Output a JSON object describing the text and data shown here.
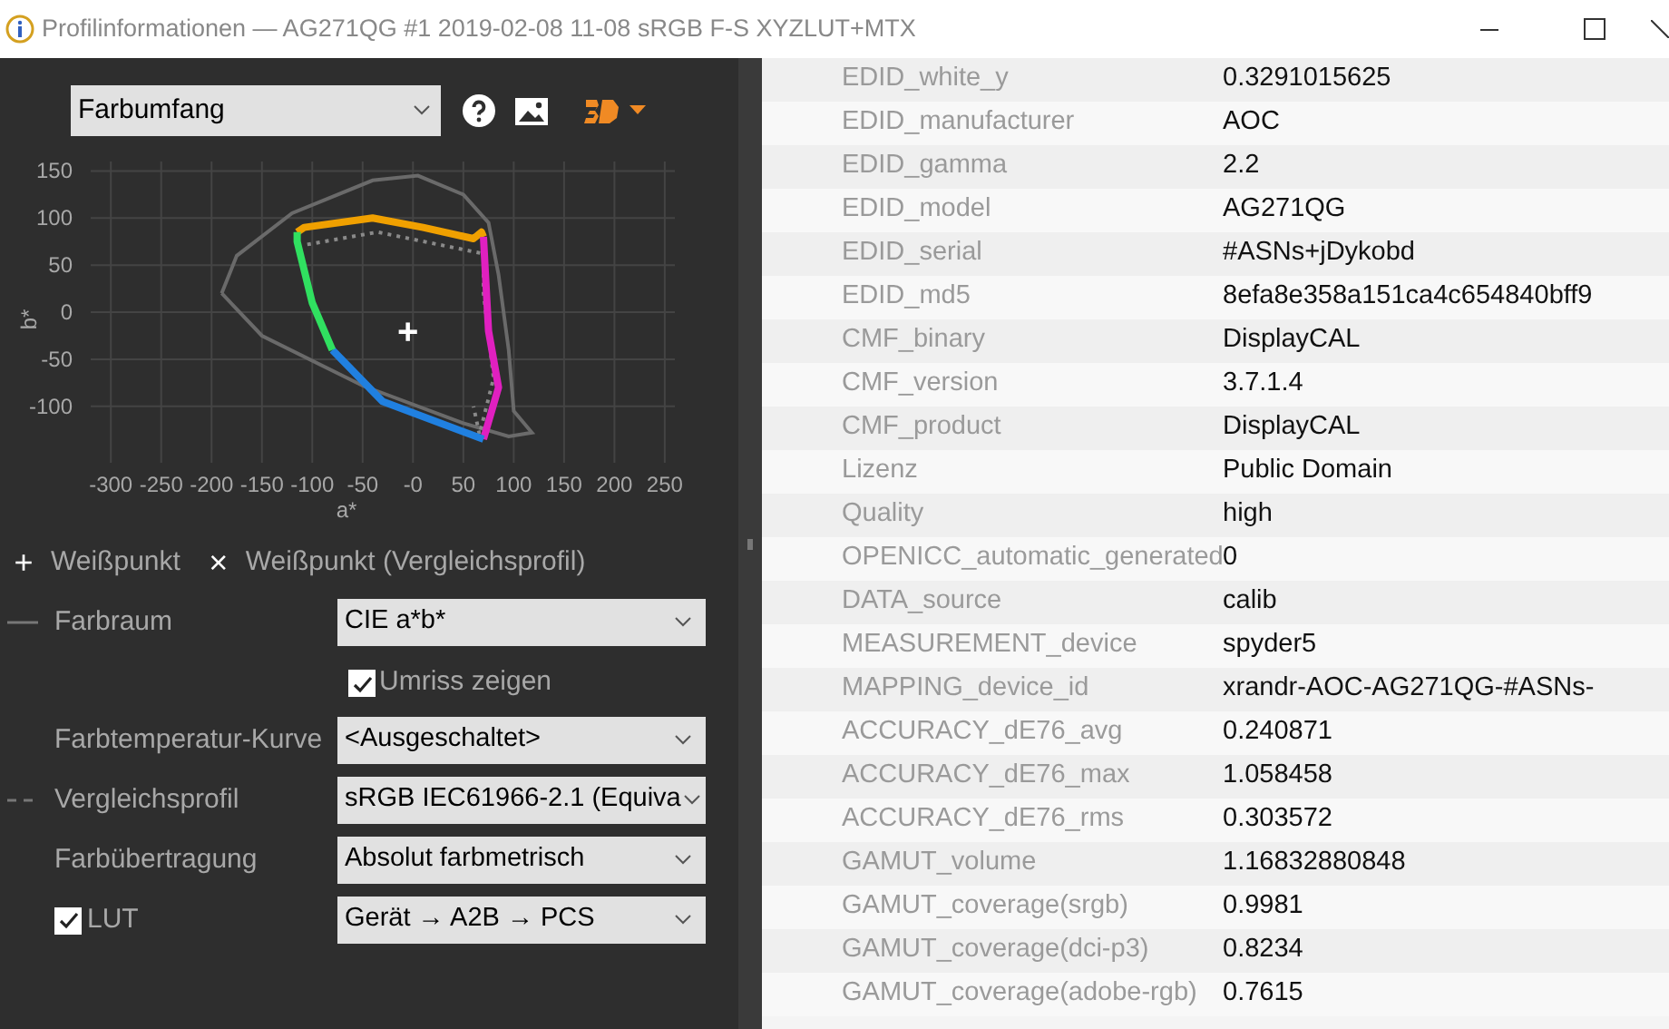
{
  "window": {
    "title": "Profilinformationen — AG271QG #1 2019-02-08 11-08 sRGB F-S XYZLUT+MTX"
  },
  "left_panel": {
    "view_select": {
      "value": "Farbumfang"
    },
    "chart": {
      "chart_data": {
        "type": "line",
        "xlabel": "a*",
        "ylabel": "b*",
        "xlim": [
          -320,
          260
        ],
        "ylim": [
          -160,
          160
        ],
        "xticks": [
          -300,
          -250,
          -200,
          -150,
          -100,
          -50,
          {
            "value": 0,
            "label": "-0"
          },
          50,
          100,
          150,
          200,
          250
        ],
        "yticks": [
          150,
          100,
          50,
          0,
          -50,
          -100
        ],
        "grid": true,
        "annotations": [
          "+"
        ]
      }
    },
    "legend": [
      {
        "symbol": "+",
        "label": "Weißpunkt"
      },
      {
        "symbol": "×",
        "label": "Weißpunkt (Vergleichsprofil)"
      }
    ],
    "settings": [
      {
        "kind": "solidlineselect",
        "label": "Farbraum",
        "value": "CIE a*b*"
      },
      {
        "kind": "checkbox",
        "label": "Umriss zeigen",
        "checked": true
      },
      {
        "kind": "select",
        "label": "Farbtemperatur-Kurve",
        "value": "<Ausgeschaltet>"
      },
      {
        "kind": "dashedlineselect",
        "label": "Vergleichsprofil",
        "value": "sRGB IEC61966-2.1 (Equiva"
      },
      {
        "kind": "select",
        "label": "Farbübertragung",
        "value": "Absolut farbmetrisch"
      },
      {
        "kind": "checkselect",
        "label": "LUT",
        "checked": true,
        "value": "Gerät → A2B → PCS"
      }
    ]
  },
  "table": {
    "rows": [
      {
        "key": "EDID_white_y",
        "value": "0.3291015625"
      },
      {
        "key": "EDID_manufacturer",
        "value": "AOC"
      },
      {
        "key": "EDID_gamma",
        "value": "2.2"
      },
      {
        "key": "EDID_model",
        "value": "AG271QG"
      },
      {
        "key": "EDID_serial",
        "value": "#ASNs+jDykobd"
      },
      {
        "key": "EDID_md5",
        "value": "8efa8e358a151ca4c654840bff9"
      },
      {
        "key": "CMF_binary",
        "value": "DisplayCAL"
      },
      {
        "key": "CMF_version",
        "value": "3.7.1.4"
      },
      {
        "key": "CMF_product",
        "value": "DisplayCAL"
      },
      {
        "key": "Lizenz",
        "value": "Public Domain"
      },
      {
        "key": "Quality",
        "value": "high"
      },
      {
        "key": "OPENICC_automatic_generated",
        "value": "0"
      },
      {
        "key": "DATA_source",
        "value": "calib"
      },
      {
        "key": "MEASUREMENT_device",
        "value": "spyder5"
      },
      {
        "key": "MAPPING_device_id",
        "value": "xrandr-AOC-AG271QG-#ASNs-"
      },
      {
        "key": "ACCURACY_dE76_avg",
        "value": "0.240871"
      },
      {
        "key": "ACCURACY_dE76_max",
        "value": "1.058458"
      },
      {
        "key": "ACCURACY_dE76_rms",
        "value": "0.303572"
      },
      {
        "key": "GAMUT_volume",
        "value": "1.16832880848"
      },
      {
        "key": "GAMUT_coverage(srgb)",
        "value": "0.9981"
      },
      {
        "key": "GAMUT_coverage(dci-p3)",
        "value": "0.8234"
      },
      {
        "key": "GAMUT_coverage(adobe-rgb)",
        "value": "0.7615"
      }
    ]
  }
}
